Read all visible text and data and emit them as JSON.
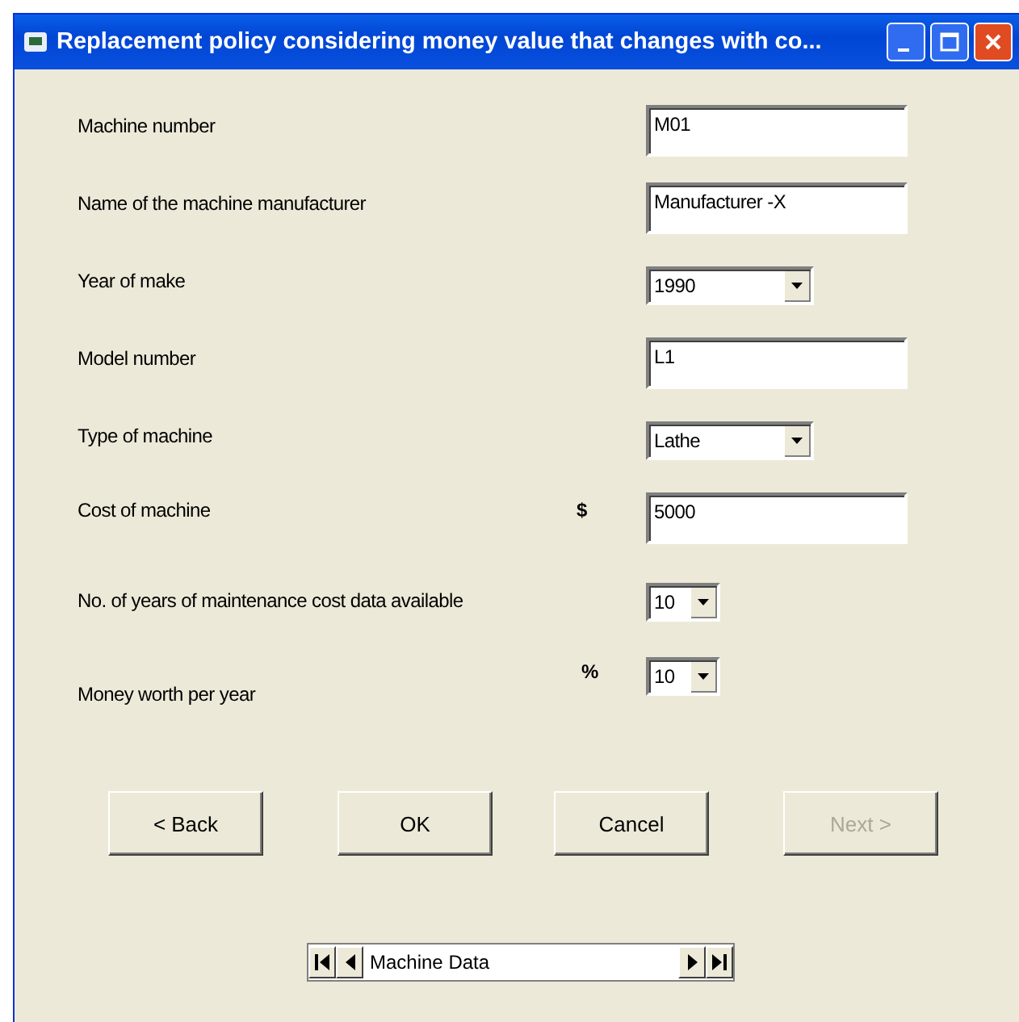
{
  "window": {
    "title": "Replacement policy considering money value that changes with co..."
  },
  "fields": [
    {
      "label": "Machine number",
      "kind": "text",
      "value": "M01"
    },
    {
      "label": "Name of the machine manufacturer",
      "kind": "text",
      "value": "Manufacturer -X"
    },
    {
      "label": "Year of make",
      "kind": "combo",
      "value": "1990"
    },
    {
      "label": "Model number",
      "kind": "text",
      "value": "L1"
    },
    {
      "label": "Type of machine",
      "kind": "combo",
      "value": "Lathe"
    },
    {
      "label": "Cost of machine",
      "kind": "text",
      "unit": "$",
      "value": "5000"
    },
    {
      "label": "No. of years of maintenance cost data available",
      "kind": "small-combo",
      "value": "10"
    },
    {
      "label": "Money worth per year",
      "kind": "small-combo",
      "unit": "%",
      "value": "10"
    }
  ],
  "buttons": [
    {
      "label": "< Back",
      "disabled": false
    },
    {
      "label": "OK",
      "disabled": false
    },
    {
      "label": "Cancel",
      "disabled": false
    },
    {
      "label": "Next >",
      "disabled": true
    }
  ],
  "navigator": {
    "caption": "Machine Data"
  }
}
